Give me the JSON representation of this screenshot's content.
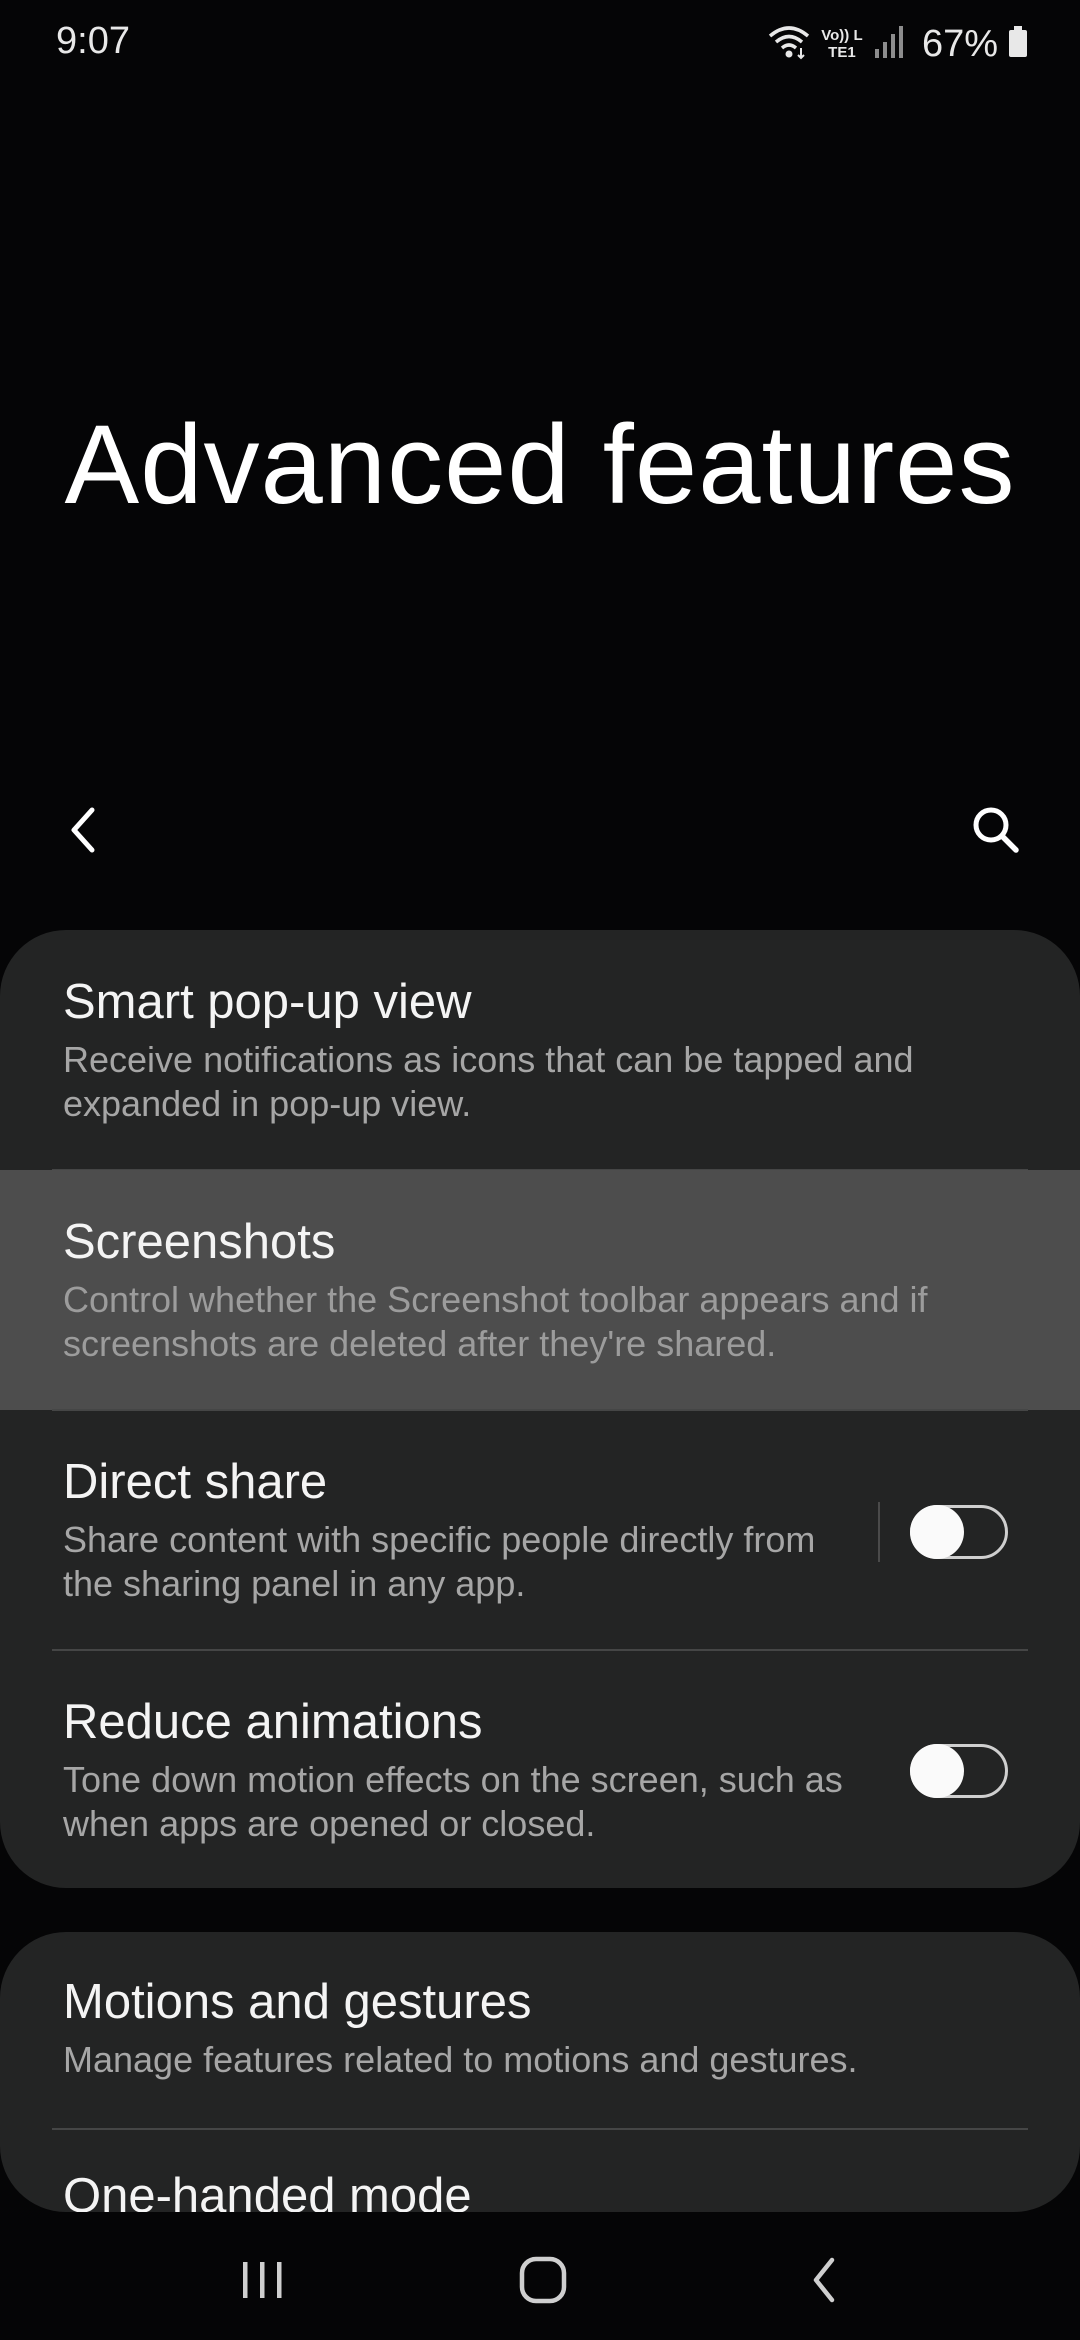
{
  "status_bar": {
    "time": "9:07",
    "network_label": "Vo)) LTE1",
    "battery": "67%",
    "icons": [
      "wifi-icon",
      "volte-lte-icon",
      "signal-icon",
      "battery-icon"
    ]
  },
  "header": {
    "title": "Advanced features",
    "back_icon": "back-chevron-icon",
    "search_icon": "search-icon"
  },
  "settings": {
    "card1": [
      {
        "title": "Smart pop-up view",
        "summary": "Receive notifications as icons that can be tapped and expanded in pop-up view."
      },
      {
        "title": "Screenshots",
        "summary": "Control whether the Screenshot toolbar appears and if screenshots are deleted after they're shared.",
        "highlighted": true
      },
      {
        "title": "Direct share",
        "summary": "Share content with specific people directly from the sharing panel in any app.",
        "toggle": false
      },
      {
        "title": "Reduce animations",
        "summary": "Tone down motion effects on the screen, such as when apps are opened or closed.",
        "toggle": false
      }
    ],
    "card2": [
      {
        "title": "Motions and gestures",
        "summary": "Manage features related to motions and gestures."
      },
      {
        "title": "One-handed mode"
      }
    ]
  },
  "nav_bar": {
    "icons": [
      "recents-icon",
      "home-icon",
      "back-icon"
    ]
  },
  "colors": {
    "background": "#050506",
    "card": "#232424",
    "highlight": "#4d4d4d",
    "summary_text": "#a6a6a6",
    "divider": "#454646"
  }
}
